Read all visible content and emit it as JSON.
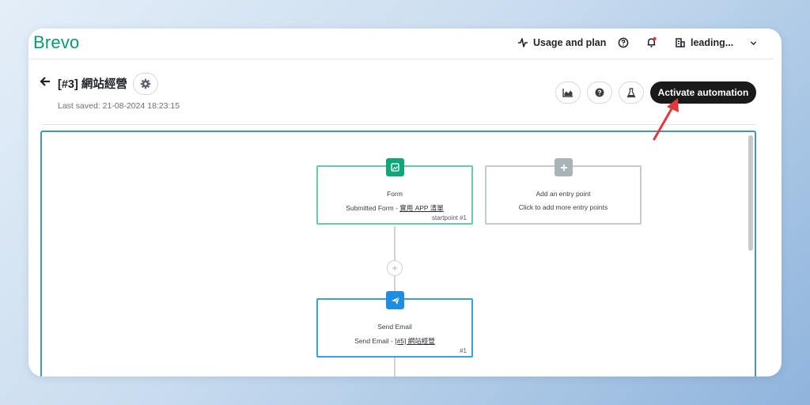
{
  "header": {
    "logo": "Brevo",
    "usage_label": "Usage and plan",
    "account_label": "leading..."
  },
  "page": {
    "title": "[#3] 網站經營",
    "last_saved": "Last saved: 21-08-2024 18:23:15"
  },
  "toolbar": {
    "activate_label": "Activate automation"
  },
  "workflow": {
    "nodes": [
      {
        "title": "Form",
        "subtitle_prefix": "Submitted Form - ",
        "subtitle_link": "實用 APP 清單",
        "footer": "startpoint #1",
        "icon": "image-icon"
      },
      {
        "title": "Add an entry point",
        "subtitle": "Click to add more entry points",
        "icon": "plus-icon"
      },
      {
        "title": "Send Email",
        "subtitle_prefix": "Send Email - ",
        "subtitle_link": "[#5] 網站經營",
        "footer": "#1",
        "icon": "paper-plane-icon"
      }
    ],
    "add_step_symbol": "+"
  },
  "colors": {
    "brand_green": "#0b996e",
    "form_badge": "#12a47a",
    "entry_badge": "#a9b4b8",
    "email_badge": "#1e8fe0",
    "activate_bg": "#1a1a1a",
    "annotation_arrow": "#e5383b"
  }
}
